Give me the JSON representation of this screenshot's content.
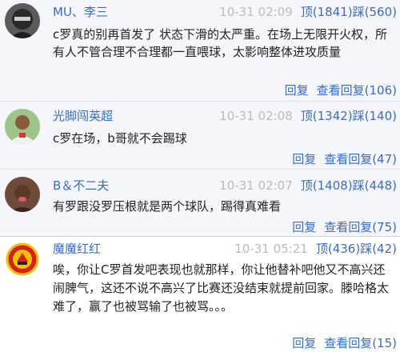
{
  "comments": [
    {
      "user": "MU、李三",
      "time": "10-31 02:09",
      "up": "顶(1841)",
      "down": "踩(560)",
      "text": "c罗真的别再首发了 状态下滑的太严重。在场上无限开火权，所有人不管合理不合理都一直喂球，太影响整体进攻质量",
      "reply": "回复",
      "view": "查看回复(106)",
      "avatar": "dark-hood-avatar"
    },
    {
      "user": "光脚闯英超",
      "time": "10-31 02:08",
      "up": "顶(1342)",
      "down": "踩(140)",
      "text": "c罗在场，b哥就不会踢球",
      "reply": "回复",
      "view": "查看回复(47)",
      "avatar": "player-avatar"
    },
    {
      "user": "B＆不二夫",
      "time": "10-31 02:07",
      "up": "顶(1408)",
      "down": "踩(448)",
      "text": "有罗跟没罗压根就是两个球队，踢得真难看",
      "reply": "回复",
      "view": "查看回复(75)",
      "avatar": "woman-avatar"
    },
    {
      "user": "魔魔红红",
      "time": "10-31 05:21",
      "up": "顶(436)",
      "down": "踩(42)",
      "text": "唉，你让C罗首发吧表现也就那样，你让他替补吧他又不高兴还闹脾气，这还不说不高兴了比赛还没结束就提前回家。滕哈格太难了，赢了也被骂输了也被骂。。。",
      "reply": "回复",
      "view": "查看回复(15)",
      "avatar": "manutd-crest-avatar"
    }
  ]
}
